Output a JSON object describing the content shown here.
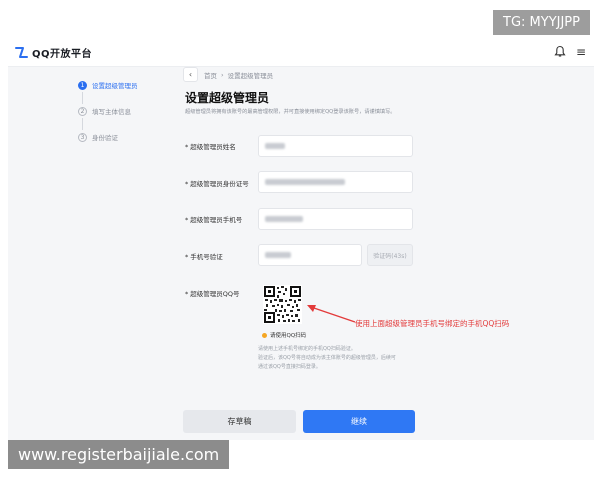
{
  "watermarks": {
    "top_right": "TG: MYYJJPP",
    "bottom_left": "www.registerbaijiale.com"
  },
  "header": {
    "brand": "QQ开放平台",
    "icons": [
      "bell-icon",
      "menu-icon"
    ]
  },
  "steps": [
    {
      "num": "1",
      "label": "设置超级管理员",
      "active": true
    },
    {
      "num": "2",
      "label": "填写主体信息",
      "active": false
    },
    {
      "num": "3",
      "label": "身份验证",
      "active": false
    }
  ],
  "breadcrumb": {
    "back": "‹",
    "home": "首页",
    "separator": "›",
    "current": "设置超级管理员"
  },
  "main": {
    "title": "设置超级管理员",
    "description": "超级管理员将拥有该账号的最高管理权限，并可直接使用绑定QQ登录该账号，请谨慎填写。"
  },
  "form": {
    "name_label": "超级管理员姓名",
    "id_label": "超级管理员身份证号",
    "phone_label": "超级管理员手机号",
    "verify_label": "手机号验证",
    "code_button": "验证码(43s)",
    "qq_label": "超级管理员QQ号",
    "required_mark": "*",
    "qr_hint": "请使用QQ扫码",
    "notes": [
      "请使用上述手机号绑定的手机QQ扫码验证。",
      "验证后，该QQ号将自动成为该主体账号的超级管理员，后续可",
      "通过该QQ号直接扫码登录。"
    ]
  },
  "annotation": {
    "text": "使用上面超级管理员手机号绑定的手机QQ扫码",
    "color": "#e33b3b"
  },
  "footer": {
    "draft_label": "存草稿",
    "next_label": "继续"
  },
  "colors": {
    "accent": "#2f78f4",
    "background": "#f5f6f8"
  }
}
